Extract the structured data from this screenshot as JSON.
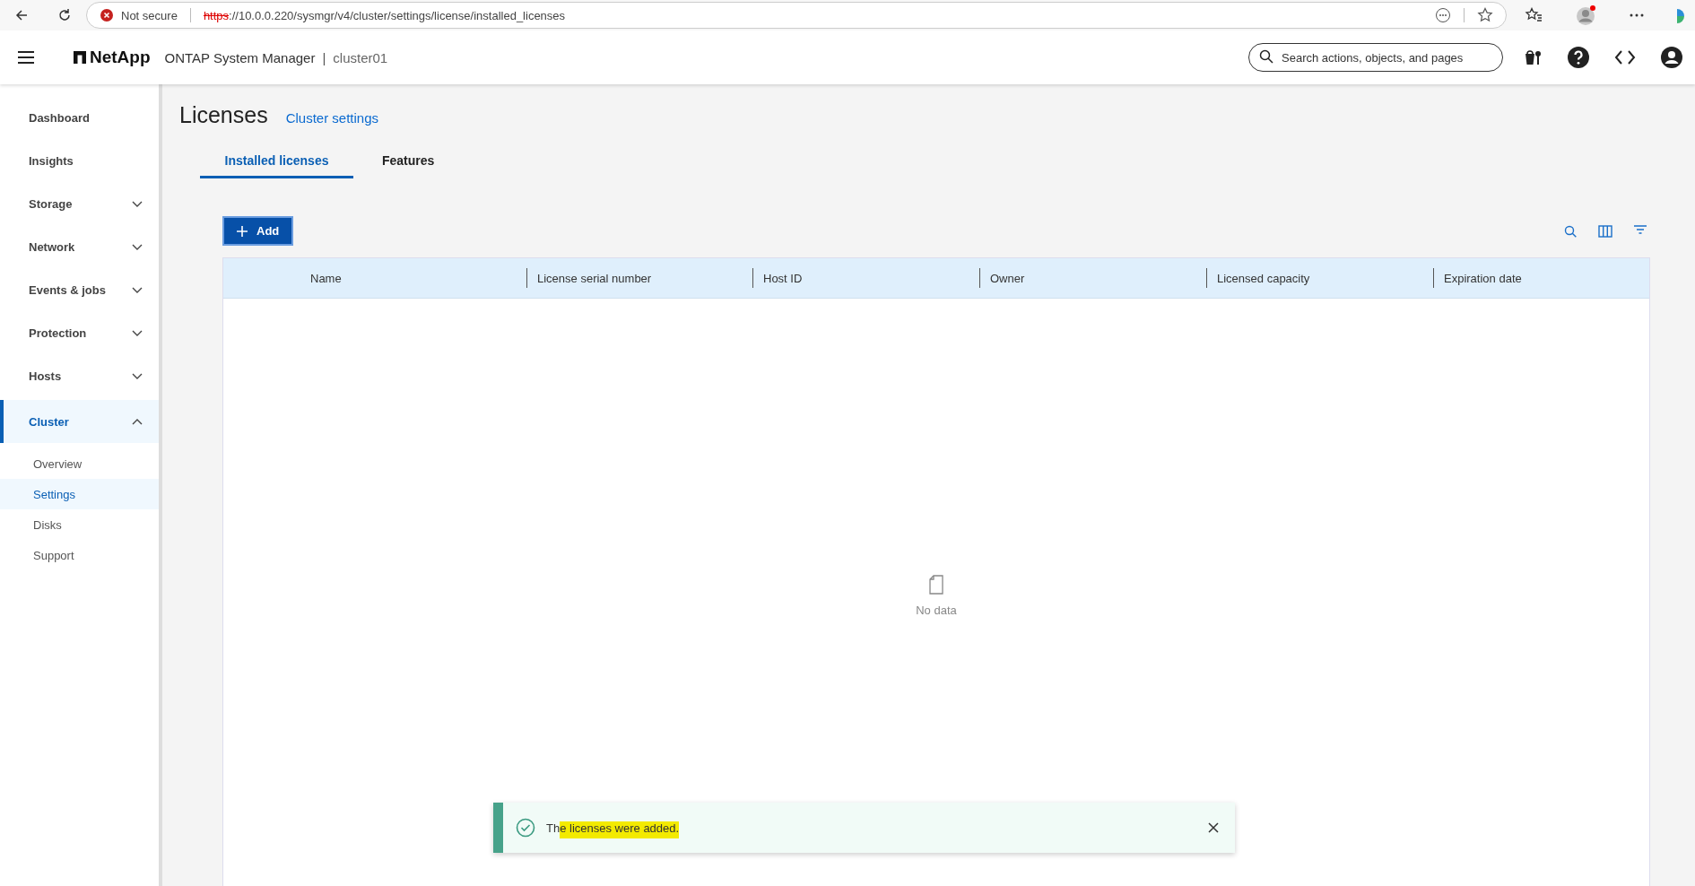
{
  "browser": {
    "security": "Not secure",
    "url_scheme": "https",
    "url_rest": "://10.0.0.220/sysmgr/v4/cluster/settings/license/installed_licenses"
  },
  "header": {
    "brand": "NetApp",
    "product": "ONTAP System Manager",
    "separator": "|",
    "cluster": "cluster01",
    "search": {
      "placeholder": "Search actions, objects, and pages"
    }
  },
  "sidebar": {
    "items": [
      {
        "label": "Dashboard",
        "kind": "link",
        "selected": false
      },
      {
        "label": "Insights",
        "kind": "link",
        "selected": false
      },
      {
        "label": "Storage",
        "kind": "group",
        "expanded": false,
        "selected": false
      },
      {
        "label": "Network",
        "kind": "group",
        "expanded": false,
        "selected": false
      },
      {
        "label": "Events & jobs",
        "kind": "group",
        "expanded": false,
        "selected": false
      },
      {
        "label": "Protection",
        "kind": "group",
        "expanded": false,
        "selected": false
      },
      {
        "label": "Hosts",
        "kind": "group",
        "expanded": false,
        "selected": false
      },
      {
        "label": "Cluster",
        "kind": "group",
        "expanded": true,
        "selected": true,
        "children": [
          {
            "label": "Overview",
            "selected": false
          },
          {
            "label": "Settings",
            "selected": true
          },
          {
            "label": "Disks",
            "selected": false
          },
          {
            "label": "Support",
            "selected": false
          }
        ]
      }
    ]
  },
  "page": {
    "title": "Licenses",
    "link": "Cluster settings",
    "tabs": [
      {
        "label": "Installed licenses",
        "selected": true
      },
      {
        "label": "Features",
        "selected": false
      }
    ],
    "add_button": "Add",
    "table": {
      "columns": [
        "Name",
        "License serial number",
        "Host ID",
        "Owner",
        "Licensed capacity",
        "Expiration date"
      ],
      "empty_text": "No data"
    }
  },
  "toast": {
    "kind": "success",
    "message_start": "Th",
    "message_highlighted": "e licenses were added."
  }
}
